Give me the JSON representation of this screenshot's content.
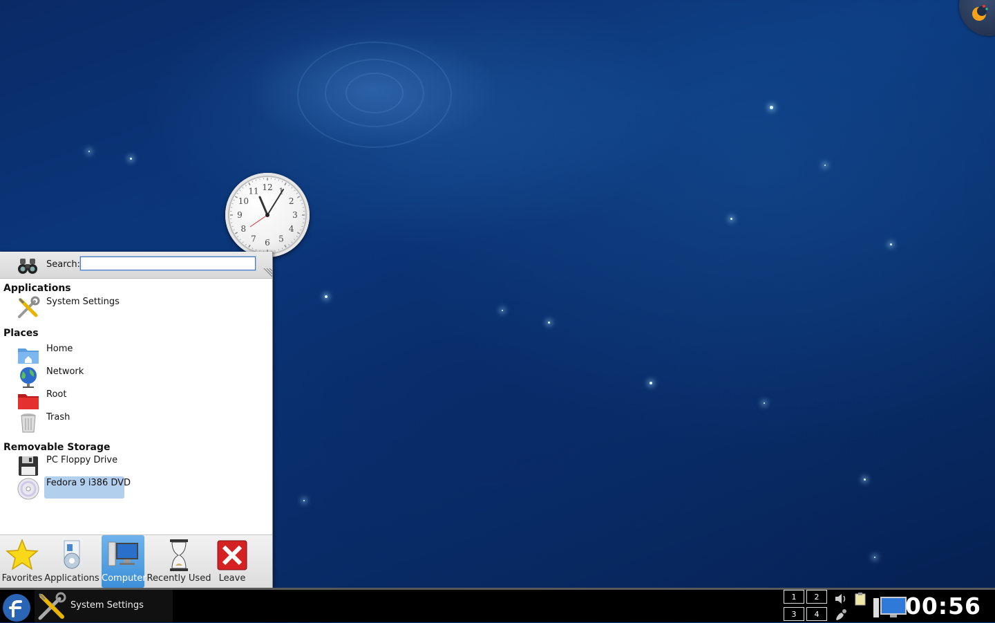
{
  "clock_widget": {
    "numerals": [
      "12",
      "1",
      "2",
      "3",
      "4",
      "5",
      "6",
      "7",
      "8",
      "9",
      "10",
      "11"
    ]
  },
  "launcher": {
    "search_label": "Search:",
    "search_value": "",
    "sections": {
      "applications": {
        "title": "Applications",
        "items": [
          {
            "label": "System Settings",
            "icon": "tools-icon"
          }
        ]
      },
      "places": {
        "title": "Places",
        "items": [
          {
            "label": "Home",
            "icon": "home-folder-icon"
          },
          {
            "label": "Network",
            "icon": "network-globe-icon"
          },
          {
            "label": "Root",
            "icon": "red-folder-icon"
          },
          {
            "label": "Trash",
            "icon": "trash-icon"
          }
        ]
      },
      "removable": {
        "title": "Removable Storage",
        "items": [
          {
            "label": "PC Floppy Drive",
            "icon": "floppy-icon"
          },
          {
            "label": "Fedora 9 i386 DVD",
            "icon": "dvd-icon"
          }
        ]
      }
    },
    "tabs": [
      {
        "label": "Favorites",
        "icon": "star-icon"
      },
      {
        "label": "Applications",
        "icon": "applications-icon"
      },
      {
        "label": "Computer",
        "icon": "computer-icon",
        "active": true
      },
      {
        "label": "Recently Used",
        "icon": "hourglass-icon"
      },
      {
        "label": "Leave",
        "icon": "leave-icon"
      }
    ]
  },
  "taskbar": {
    "task_label": "System Settings",
    "pager": [
      "1",
      "2",
      "3",
      "4"
    ],
    "time": "00:56"
  },
  "colors": {
    "accent": "#3c8fd8",
    "selection": "#b3cfee",
    "taskbar": "#000000"
  }
}
